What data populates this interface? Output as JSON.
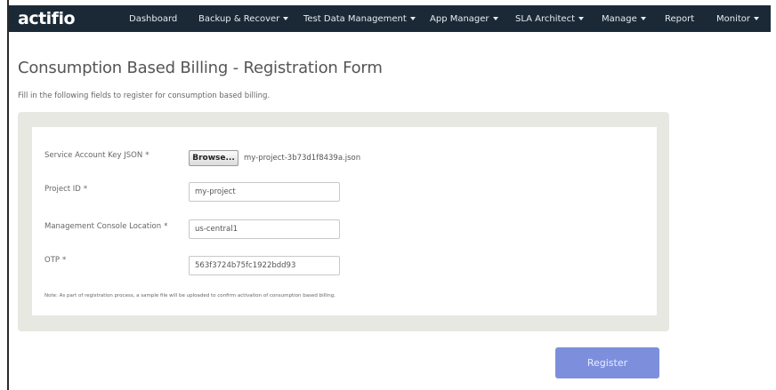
{
  "nav": {
    "logo": "actifio",
    "items": [
      {
        "label": "Dashboard",
        "dropdown": false
      },
      {
        "label": "Backup & Recover",
        "dropdown": true
      },
      {
        "label": "Test Data Management",
        "dropdown": true
      },
      {
        "label": "App Manager",
        "dropdown": true
      },
      {
        "label": "SLA Architect",
        "dropdown": true
      },
      {
        "label": "Manage",
        "dropdown": true
      },
      {
        "label": "Report",
        "dropdown": false
      },
      {
        "label": "Monitor",
        "dropdown": true
      }
    ]
  },
  "page": {
    "title": "Consumption Based Billing - Registration Form",
    "subtitle": "Fill in the following fields to register for consumption based billing."
  },
  "form": {
    "service_account": {
      "label": "Service Account Key JSON",
      "required": "*",
      "browse_label": "Browse...",
      "file_name": "my-project-3b73d1f8439a.json"
    },
    "project_id": {
      "label": "Project ID",
      "required": "*",
      "value": "my-project"
    },
    "console_location": {
      "label": "Management Console Location",
      "required": "*",
      "value": "us-central1"
    },
    "otp": {
      "label": "OTP",
      "required": "*",
      "value": "563f3724b75fc1922bdd93"
    },
    "note": "Note: As part of registration process, a sample file will be uploaded to confirm activation of consumption based billing.",
    "register_label": "Register"
  },
  "colors": {
    "navbar": "#1b2937",
    "panel": "#e7e8e2",
    "register_button": "#7d8fdc"
  }
}
